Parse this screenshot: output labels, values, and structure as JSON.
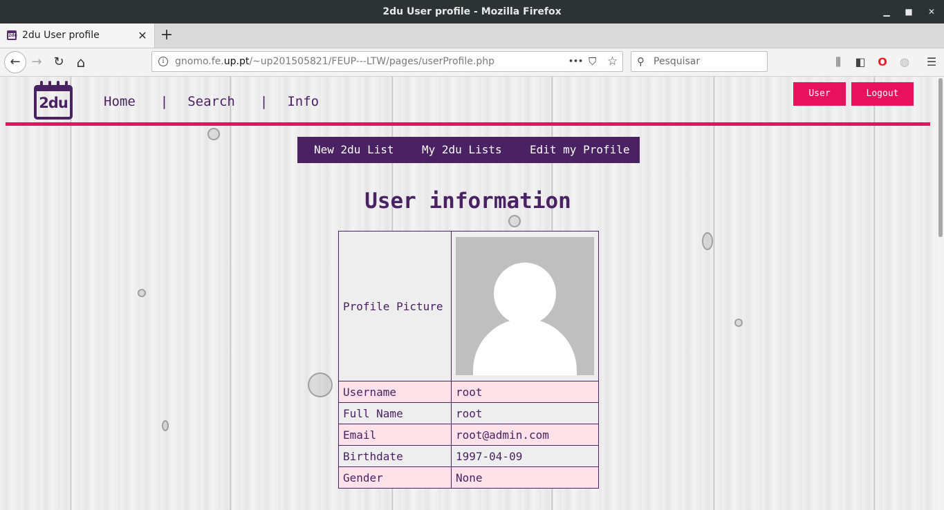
{
  "window": {
    "title": "2du User profile - Mozilla Firefox",
    "minimize": "▁",
    "maximize": "■",
    "close": "✕"
  },
  "browser": {
    "tab_label": "2du User profile",
    "tab_favicon_text": "2du",
    "tab_close": "✕",
    "new_tab": "+",
    "url_host_prefix": "gnomo.fe.",
    "url_host_domain": "up.pt",
    "url_path": "/~up201505821/FEUP---LTW/pages/userProfile.php",
    "search_placeholder": "Pesquisar",
    "icons": {
      "back": "←",
      "forward": "→",
      "reload": "↻",
      "home": "⌂",
      "info": "i",
      "more": "•••",
      "pocket": "⛉",
      "bookmark": "☆",
      "search": "⚲",
      "library": "⫼",
      "sidebar": "◧",
      "opera": "O",
      "globe": "◍",
      "menu": "☰"
    }
  },
  "site": {
    "logo_text": "2du",
    "nav": {
      "home": "Home",
      "sep": "|",
      "search": "Search",
      "info": "Info"
    },
    "user_button": "User",
    "logout_button": "Logout",
    "subnav": {
      "new_list": "New 2du List",
      "my_lists": "My 2du Lists",
      "edit_profile": "Edit my Profile"
    },
    "heading": "User information",
    "profile": {
      "picture_label": "Profile Picture",
      "rows": [
        {
          "key": "Username",
          "value": "root"
        },
        {
          "key": "Full Name",
          "value": "root"
        },
        {
          "key": "Email",
          "value": "root@admin.com"
        },
        {
          "key": "Birthdate",
          "value": "1997-04-09"
        },
        {
          "key": "Gender",
          "value": "None"
        }
      ]
    }
  },
  "colors": {
    "brand_purple": "#4a2163",
    "accent_pink": "#e8125c",
    "row_pink": "#fde2ea"
  }
}
